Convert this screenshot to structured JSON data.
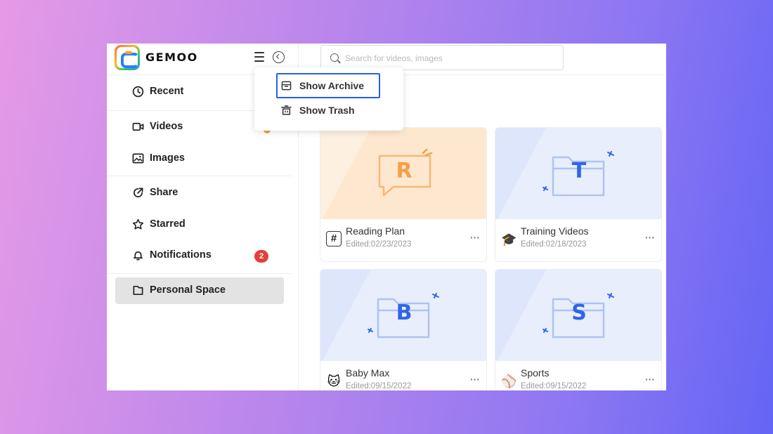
{
  "app": {
    "name": "GEMOO"
  },
  "search": {
    "placeholder": "Search for videos, images"
  },
  "sidebar": {
    "items": [
      {
        "label": "Recent",
        "icon": "clock-icon"
      },
      {
        "label": "Videos",
        "icon": "video-icon"
      },
      {
        "label": "Images",
        "icon": "image-icon"
      },
      {
        "label": "Share",
        "icon": "share-icon"
      },
      {
        "label": "Starred",
        "icon": "star-icon"
      },
      {
        "label": "Notifications",
        "icon": "bell-icon",
        "badge": "2"
      },
      {
        "label": "Personal Space",
        "icon": "folder-icon",
        "active": true
      }
    ]
  },
  "dropdown": {
    "items": [
      {
        "label": "Show Archive",
        "icon": "archive-icon",
        "highlighted": true
      },
      {
        "label": "Show Trash",
        "icon": "trash-icon"
      }
    ]
  },
  "cards": [
    {
      "letter": "R",
      "title": "Reading Plan",
      "edited": "Edited:02/23/2023",
      "icon": "hash-icon",
      "more": "···"
    },
    {
      "letter": "T",
      "title": "Training Videos",
      "edited": "Edited:02/18/2023",
      "icon": "graduation-cap-icon",
      "emoji": "🎓",
      "more": "···"
    },
    {
      "letter": "B",
      "title": "Baby Max",
      "edited": "Edited:09/15/2022",
      "icon": "cat-icon",
      "emoji": "🐱",
      "more": "···"
    },
    {
      "letter": "S",
      "title": "Sports",
      "edited": "Edited:09/15/2022",
      "icon": "baseball-icon",
      "emoji": "⚾",
      "more": "···"
    }
  ],
  "colors": {
    "accent_blue": "#2a5ee8",
    "badge_red": "#e2403a",
    "card_orange_bg": "#fdf0e0",
    "card_blue_bg": "#dde6fb",
    "letter_orange": "#f5a04a",
    "letter_blue": "#2f66e6"
  }
}
